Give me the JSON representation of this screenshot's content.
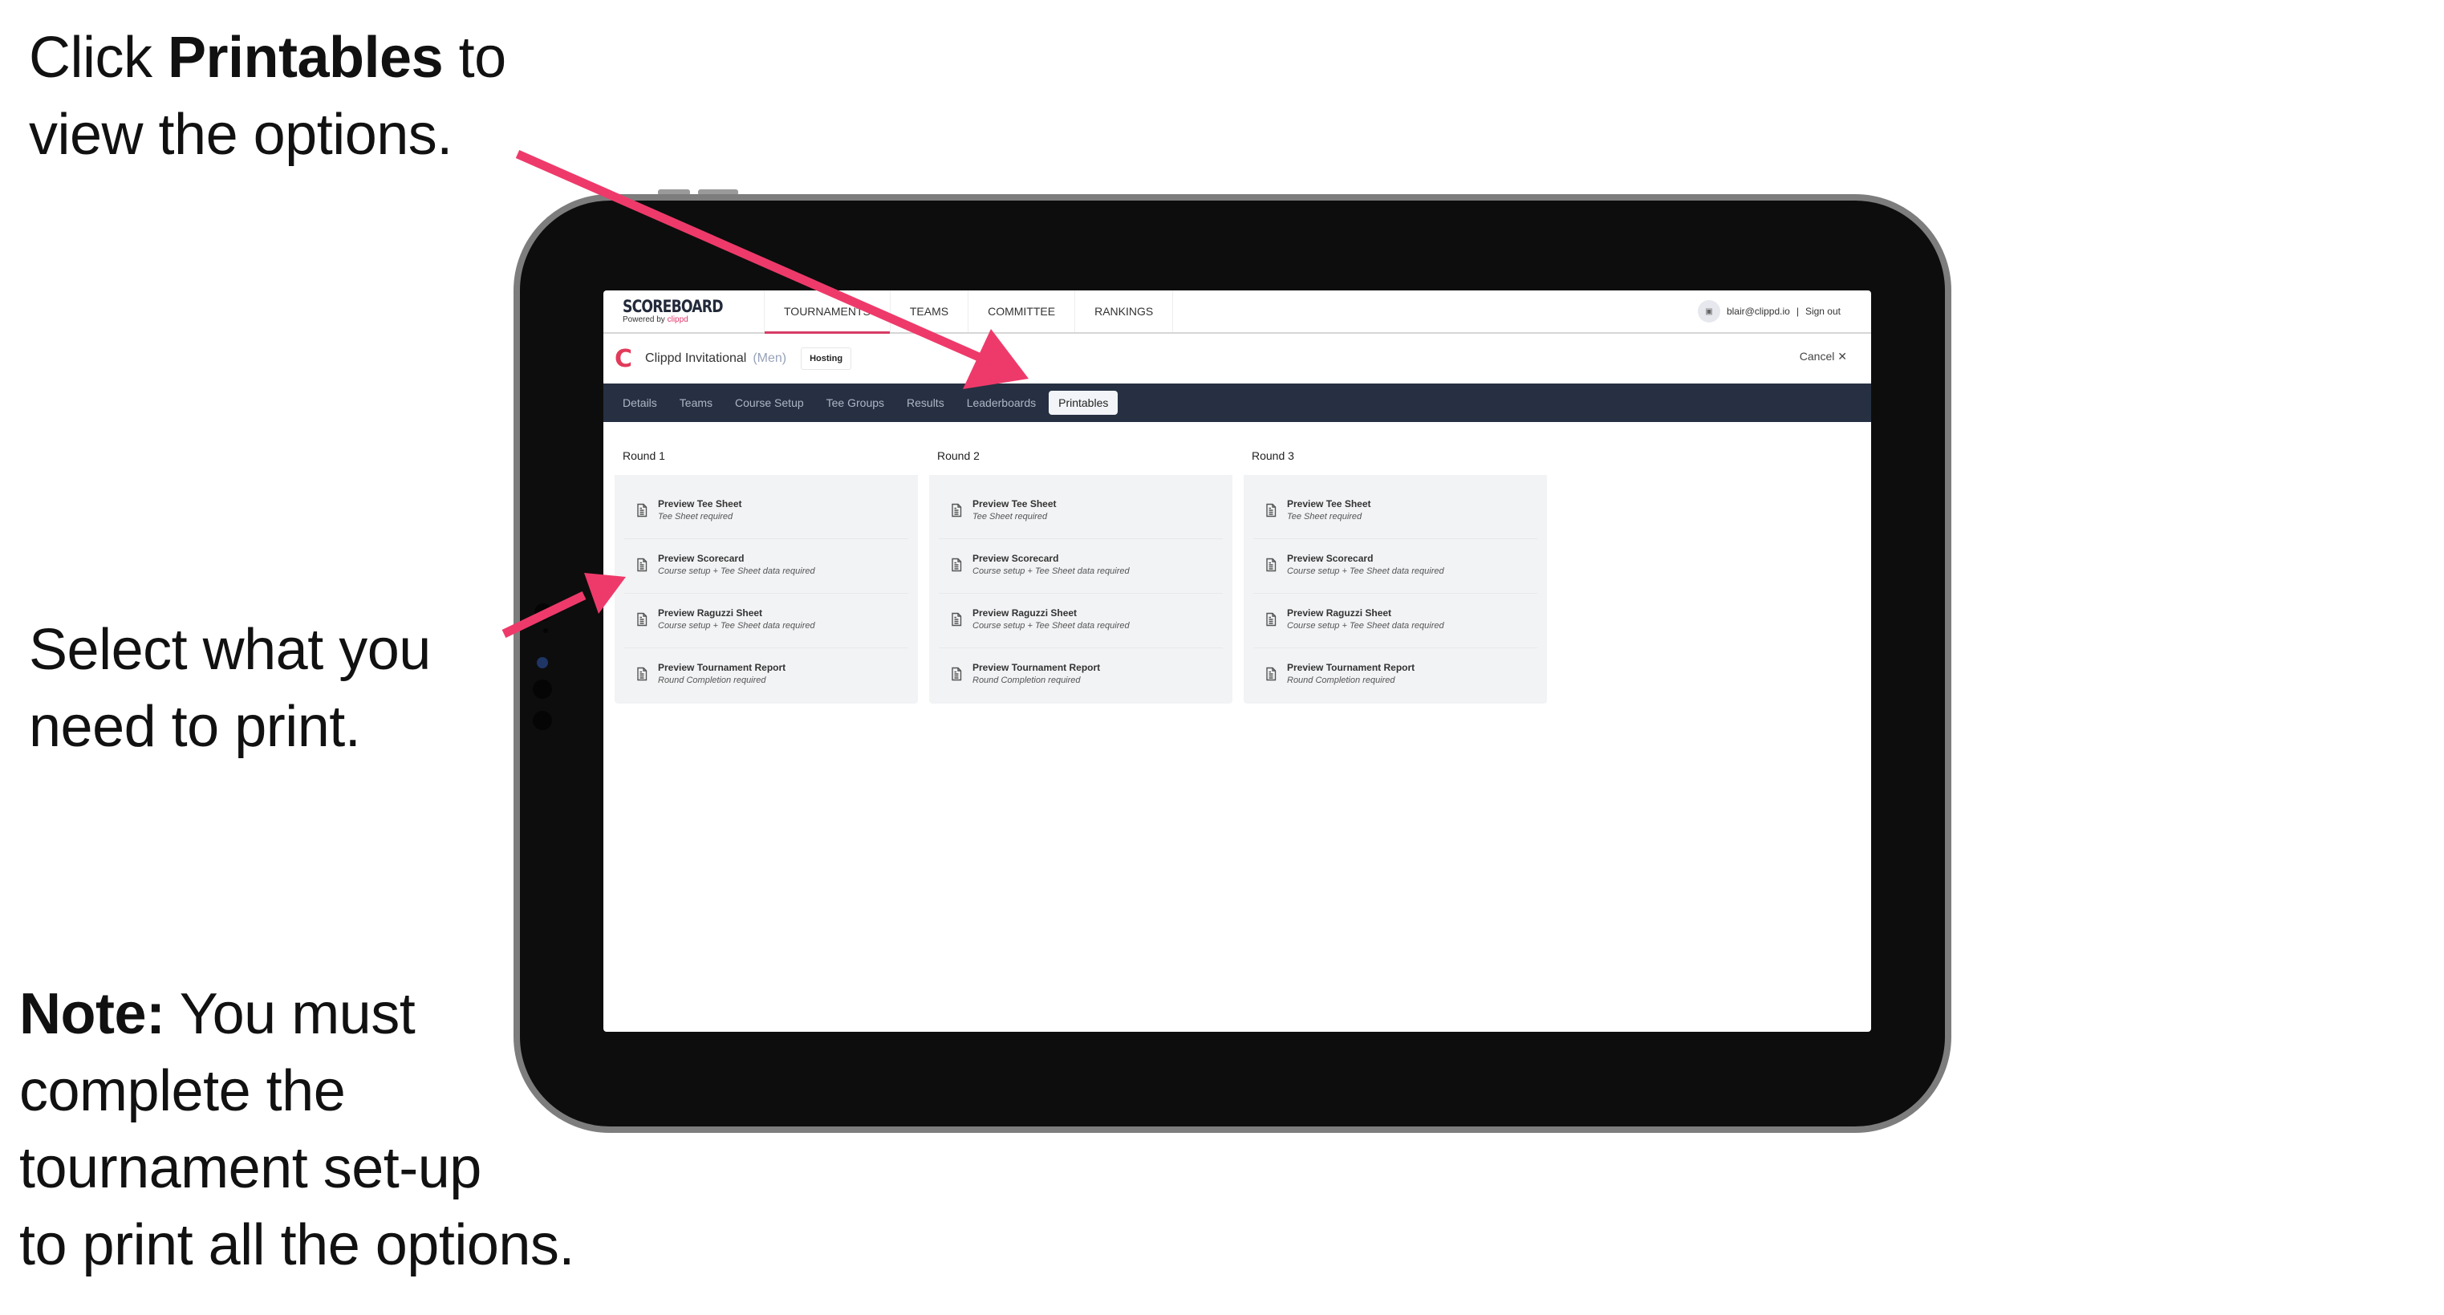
{
  "annotations": {
    "step1": {
      "pre": "Click ",
      "bold": "Printables",
      "post": " to",
      "line2": "view the options."
    },
    "step2": {
      "line1": "Select what you",
      "line2": "need to print."
    },
    "note": {
      "bold": "Note:",
      "line1": " You must",
      "line2": "complete the",
      "line3": "tournament set-up",
      "line4": "to print all the options."
    },
    "arrow_color": "#ee3a6a"
  },
  "app": {
    "brand": {
      "title": "SCOREBOARD",
      "powered_by": "Powered by ",
      "powered_brand": "clippd"
    },
    "nav": [
      "TOURNAMENTS",
      "TEAMS",
      "COMMITTEE",
      "RANKINGS"
    ],
    "active_nav": "TOURNAMENTS",
    "user": {
      "avatar_icon": "image-placeholder-icon",
      "email": "blair@clippd.io",
      "separator": "|",
      "sign_out": "Sign out"
    },
    "event": {
      "logo": "C",
      "name": "Clippd Invitational",
      "division": "(Men)",
      "badge": "Hosting",
      "cancel": "Cancel",
      "cancel_icon": "✕"
    },
    "tabs": [
      "Details",
      "Teams",
      "Course Setup",
      "Tee Groups",
      "Results",
      "Leaderboards",
      "Printables"
    ],
    "active_tab": "Printables",
    "rounds": [
      {
        "title": "Round 1",
        "items": [
          {
            "title": "Preview Tee Sheet",
            "sub": "Tee Sheet required"
          },
          {
            "title": "Preview Scorecard",
            "sub": "Course setup + Tee Sheet data required"
          },
          {
            "title": "Preview Raguzzi Sheet",
            "sub": "Course setup + Tee Sheet data required"
          },
          {
            "title": "Preview Tournament Report",
            "sub": "Round Completion required"
          }
        ]
      },
      {
        "title": "Round 2",
        "items": [
          {
            "title": "Preview Tee Sheet",
            "sub": "Tee Sheet required"
          },
          {
            "title": "Preview Scorecard",
            "sub": "Course setup + Tee Sheet data required"
          },
          {
            "title": "Preview Raguzzi Sheet",
            "sub": "Course setup + Tee Sheet data required"
          },
          {
            "title": "Preview Tournament Report",
            "sub": "Round Completion required"
          }
        ]
      },
      {
        "title": "Round 3",
        "items": [
          {
            "title": "Preview Tee Sheet",
            "sub": "Tee Sheet required"
          },
          {
            "title": "Preview Scorecard",
            "sub": "Course setup + Tee Sheet data required"
          },
          {
            "title": "Preview Raguzzi Sheet",
            "sub": "Course setup + Tee Sheet data required"
          },
          {
            "title": "Preview Tournament Report",
            "sub": "Round Completion required"
          }
        ]
      }
    ]
  }
}
